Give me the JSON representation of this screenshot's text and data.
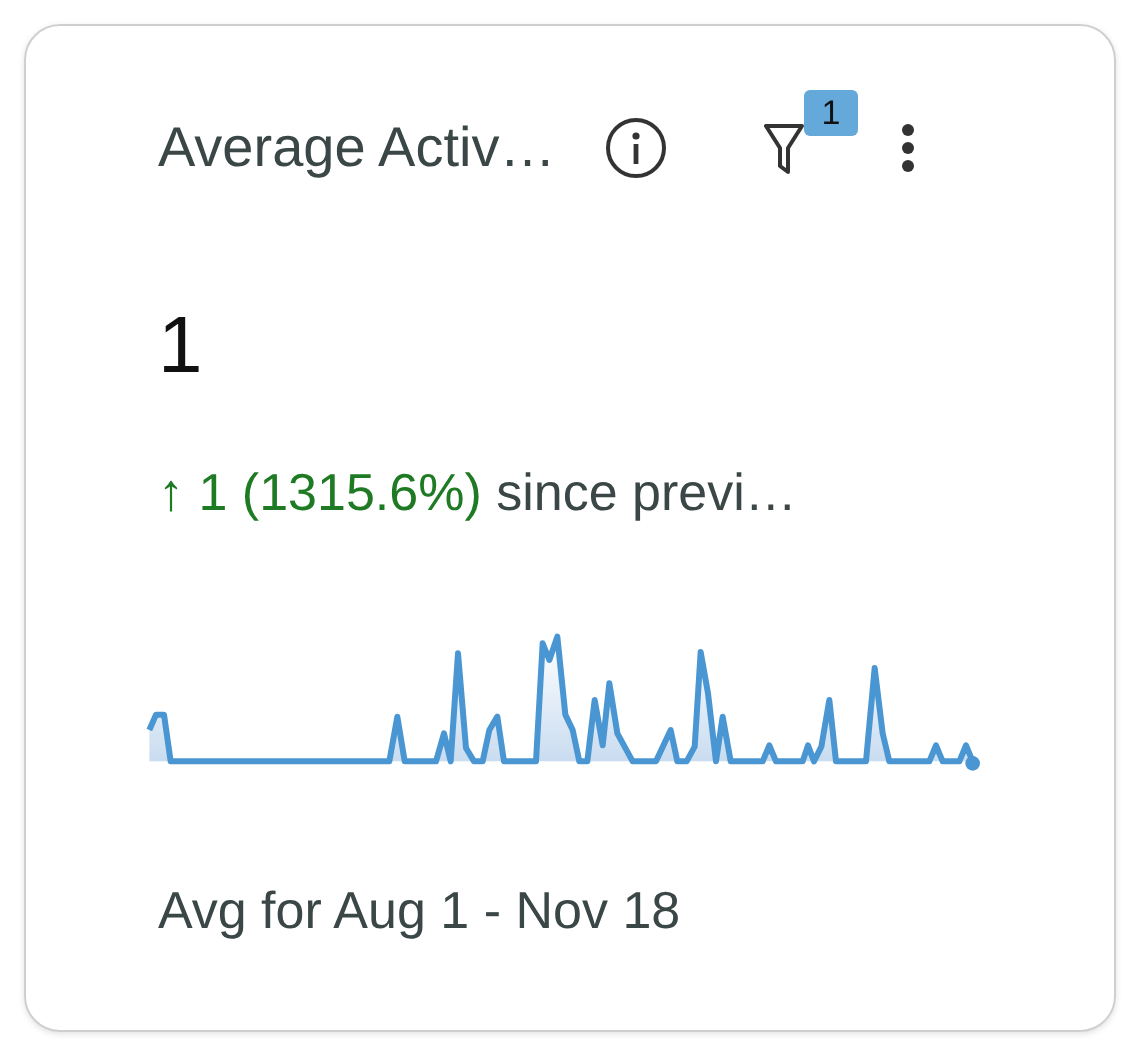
{
  "card": {
    "title": "Average Activ…",
    "filter_badge": "1",
    "value": "1",
    "change": {
      "arrow": "↑",
      "delta": "1 (1315.6%)",
      "suffix": "since previ…"
    },
    "footer": "Avg for Aug 1 - Nov 18"
  }
}
